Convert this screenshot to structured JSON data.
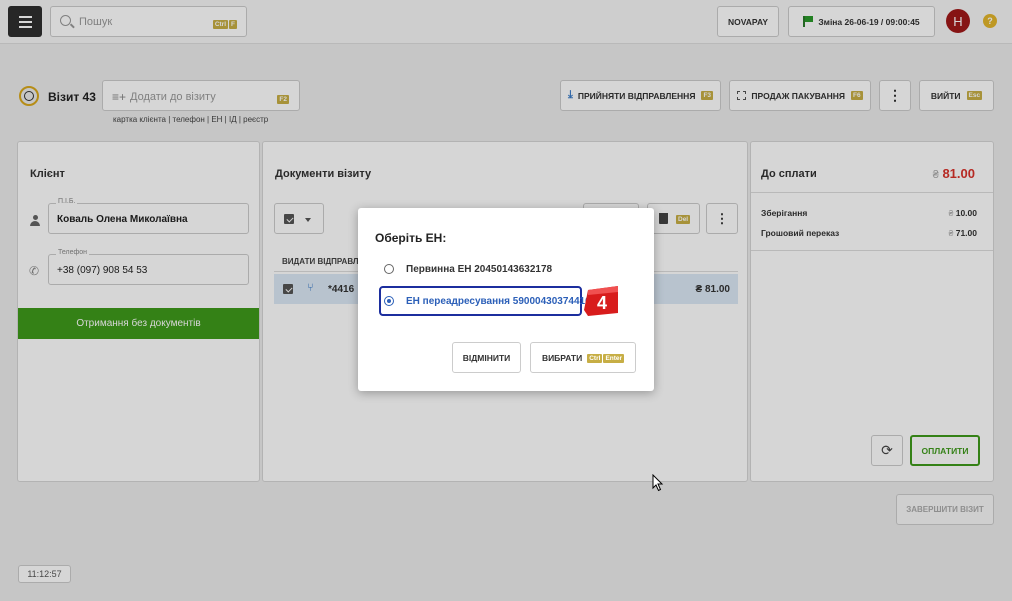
{
  "topbar": {
    "search_placeholder": "Пошук",
    "search_keys": [
      "Ctrl",
      "F"
    ],
    "novapay_label": "NOVAPAY",
    "shift_label": "Зміна 26-06-19 / 09:00:45",
    "avatar_letter": "Н",
    "help_label": "?"
  },
  "visit": {
    "title": "Візит 43",
    "add_placeholder": "Додати до візиту",
    "add_key": "F2",
    "subtitle": "картка клієнта | телефон | ЕН | ІД | реєстр",
    "accept_label": "ПРИЙНЯТИ ВІДПРАВЛЕННЯ",
    "accept_key": "F3",
    "sale_label": "ПРОДАЖ ПАКУВАННЯ",
    "sale_key": "F6",
    "exit_label": "ВИЙТИ",
    "exit_key": "Esc",
    "more_label": "⋮"
  },
  "client": {
    "title": "Клієнт",
    "name_label": "П.І.Б.",
    "name_value": "Коваль Олена Миколаївна",
    "phone_label": "Телефон",
    "phone_value": "+38 (097) 908 54 53",
    "button_label": "Отримання без документів"
  },
  "docs": {
    "title": "Документи візиту",
    "delete_key": "Del",
    "more_label": "⋮",
    "column_header": "ВИДАТИ ВІДПРАВЛЕН",
    "row": {
      "number": "*4416",
      "amount": "₴ 81.00"
    }
  },
  "payment": {
    "title": "До сплати",
    "currency": "₴",
    "total": "81.00",
    "items": [
      {
        "label": "Зберігання",
        "value": "10.00"
      },
      {
        "label": "Грошовий переказ",
        "value": "71.00"
      }
    ],
    "pay_label": "ОПЛАТИТИ",
    "refresh_label": "⟳"
  },
  "footer": {
    "finish_label": "ЗАВЕРШИТИ ВІЗИТ",
    "clock": "11:12:57"
  },
  "dialog": {
    "title": "Оберіть ЕН:",
    "options": [
      {
        "label": "Первинна ЕН 20450143632178",
        "selected": false
      },
      {
        "label": "ЕН переадресування 59000430374416",
        "selected": true
      }
    ],
    "badge": "4",
    "cancel_label": "ВІДМІНИТИ",
    "choose_label": "ВИБРАТИ",
    "choose_keys": [
      "Ctrl",
      "Enter"
    ]
  }
}
